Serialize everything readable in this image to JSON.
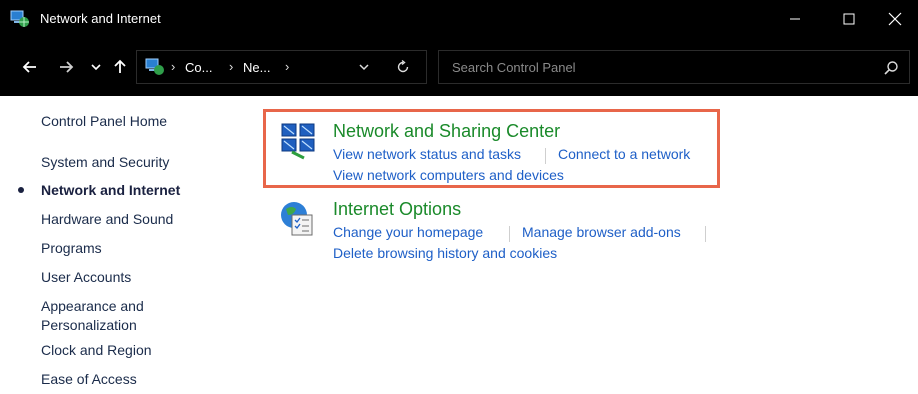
{
  "window": {
    "title": "Network and Internet",
    "icon": "network-globe-icon"
  },
  "nav": {
    "breadcrumbs": [
      "Co...",
      "Ne..."
    ],
    "search_placeholder": "Search Control Panel"
  },
  "sidebar": {
    "items": [
      {
        "label": "Control Panel Home"
      },
      {
        "label": "System and Security"
      },
      {
        "label": "Network and Internet",
        "active": true
      },
      {
        "label": "Hardware and Sound"
      },
      {
        "label": "Programs"
      },
      {
        "label": "User Accounts"
      },
      {
        "label": "Appearance and\nPersonalization"
      },
      {
        "label": "Clock and Region"
      },
      {
        "label": "Ease of Access"
      }
    ]
  },
  "main": {
    "sections": [
      {
        "title": "Network and Sharing Center",
        "icon": "network-sharing-icon",
        "links": [
          "View network status and tasks",
          "Connect to a network",
          "View network computers and devices"
        ]
      },
      {
        "title": "Internet Options",
        "icon": "internet-options-icon",
        "links": [
          "Change your homepage",
          "Manage browser add-ons",
          "Delete browsing history and cookies"
        ]
      }
    ]
  },
  "colors": {
    "section_title": "#1a8a2a",
    "link": "#1e5fc7",
    "highlight_border": "#e8664a",
    "titlebar": "#000000"
  }
}
